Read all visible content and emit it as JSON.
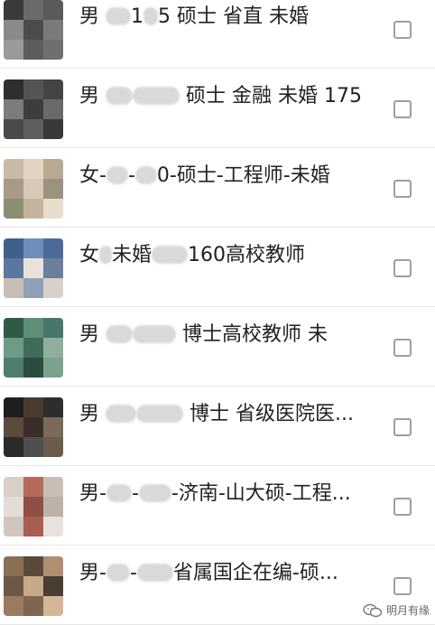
{
  "contacts": [
    {
      "parts": [
        "男 ",
        "1",
        "5 硕士 省直 未婚"
      ],
      "blur": [
        28,
        16
      ]
    },
    {
      "parts": [
        "男 ",
        "",
        " 硕士 金融 未婚 175"
      ],
      "blur": [
        30,
        52
      ]
    },
    {
      "parts": [
        "女-",
        "-",
        "0-硕士-工程师-未婚"
      ],
      "blur": [
        24,
        24
      ]
    },
    {
      "parts": [
        "女",
        "未婚",
        "160高校教师"
      ],
      "blur": [
        14,
        40
      ]
    },
    {
      "parts": [
        "男 ",
        "",
        " 博士高校教师 未"
      ],
      "blur": [
        30,
        48
      ]
    },
    {
      "parts": [
        "男 ",
        "",
        " 博士 省级医院医..."
      ],
      "blur": [
        34,
        52
      ]
    },
    {
      "parts": [
        "男-",
        "-",
        "-济南-山大硕-工程..."
      ],
      "blur": [
        28,
        36
      ]
    },
    {
      "parts": [
        "男-",
        "-",
        "省属国企在编-硕..."
      ],
      "blur": [
        26,
        40
      ]
    }
  ],
  "watermark": "明月有缘",
  "colors": {
    "avatar_palettes": [
      [
        "#3a3a3a",
        "#6b6b6b",
        "#5a5a5a",
        "#8a8a8a",
        "#4c4c4c",
        "#7a7a7a",
        "#9a9a9a",
        "#5d5d5d",
        "#6f6f6f"
      ],
      [
        "#2e2e2e",
        "#545454",
        "#444444",
        "#7c7c7c",
        "#3d3d3d",
        "#6a6a6a",
        "#4a4a4a",
        "#5f5f5f",
        "#383838"
      ],
      [
        "#c9b9a8",
        "#e2d3c3",
        "#b8a894",
        "#a89a86",
        "#d7c9b7",
        "#9d927f",
        "#8b8e70",
        "#c4b49f",
        "#e8dccc"
      ],
      [
        "#3f5f8c",
        "#6f8fba",
        "#4c6a98",
        "#5a77a2",
        "#e9e2dc",
        "#6b7f9c",
        "#c7bdb4",
        "#8ea0b8",
        "#d9d0c9"
      ],
      [
        "#2f5a48",
        "#5f8f78",
        "#47766a",
        "#6f9a88",
        "#3f6b5a",
        "#8fae9c",
        "#4f7f6c",
        "#2b4d40",
        "#7aa38f"
      ],
      [
        "#1f1f1f",
        "#4a3b30",
        "#2d2d2d",
        "#5c4a3b",
        "#3a2f28",
        "#7a6a5a",
        "#2a2a2a",
        "#4f4f4f",
        "#6b5b4d"
      ],
      [
        "#d8cfc8",
        "#b56a5a",
        "#c9beb6",
        "#e3dcd7",
        "#8f4f45",
        "#bdb2aa",
        "#cfc6bf",
        "#a85e52",
        "#e8e1dc"
      ],
      [
        "#8a6f55",
        "#5a4a3c",
        "#b08e70",
        "#6c5846",
        "#c7a989",
        "#4a3d32",
        "#9b7b60",
        "#7f664f",
        "#d4b798"
      ]
    ]
  }
}
